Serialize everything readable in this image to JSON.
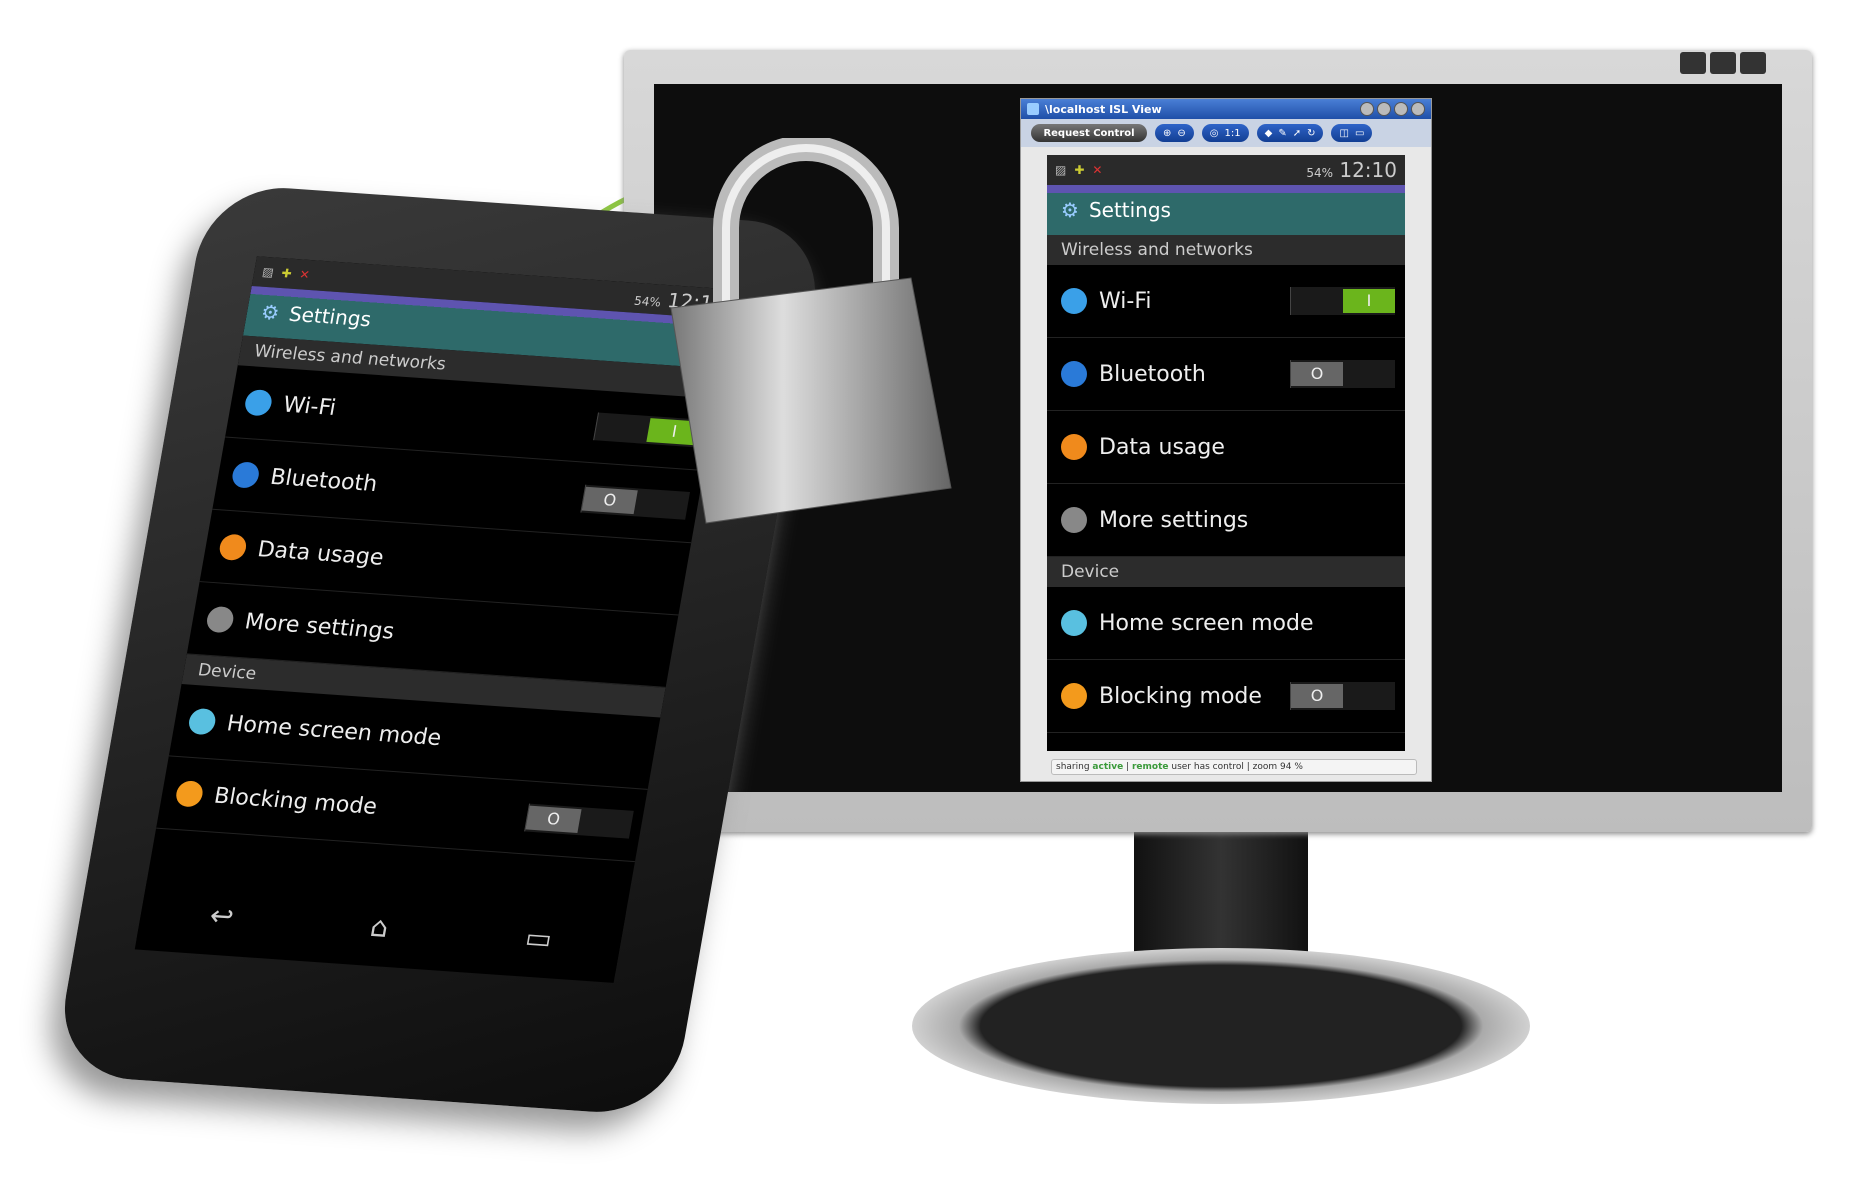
{
  "isl": {
    "title": "\\localhost ISL View",
    "request_control": "Request Control",
    "zoom_1to1": "1:1",
    "status": {
      "sharing": "sharing",
      "active": "active",
      "sep": "|",
      "remote": "remote",
      "has_control": "user has control",
      "zoom": "zoom 94 %"
    }
  },
  "android": {
    "battery": "54%",
    "time": "12:10",
    "header": "Settings",
    "sections": {
      "wireless": "Wireless and networks",
      "device": "Device"
    },
    "items": [
      {
        "label": "Wi-Fi",
        "icon": "wifi-icon",
        "toggle": "on",
        "knob": "I"
      },
      {
        "label": "Bluetooth",
        "icon": "bluetooth-icon",
        "toggle": "off",
        "knob": "O"
      },
      {
        "label": "Data usage",
        "icon": "data-usage-icon"
      },
      {
        "label": "More settings",
        "icon": "more-icon"
      },
      {
        "label": "Home screen mode",
        "icon": "home-icon"
      },
      {
        "label": "Blocking mode",
        "icon": "blocking-icon",
        "toggle": "off",
        "knob": "O"
      }
    ]
  },
  "colors": {
    "accent_green": "#8cc63f",
    "toggle_on": "#6bb51c",
    "header_teal": "#2e6a6a",
    "header_purple": "#5e54b0"
  }
}
